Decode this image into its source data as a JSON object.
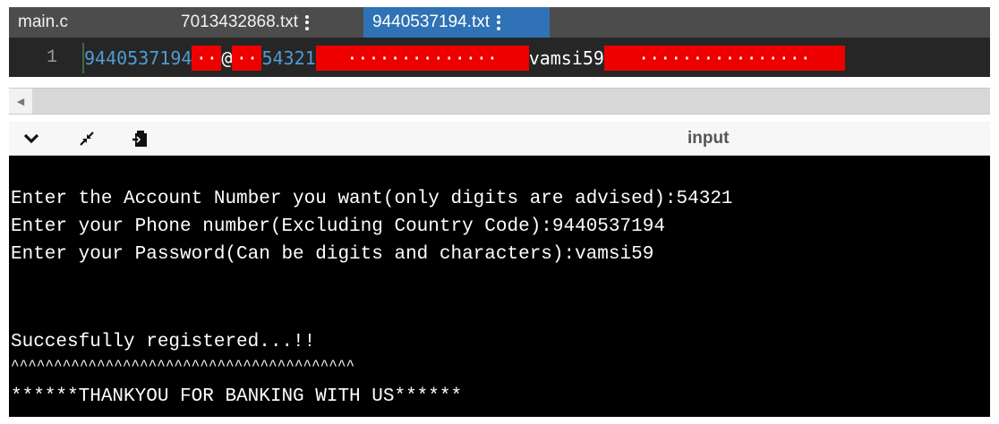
{
  "tabs": [
    {
      "label": "main.c",
      "active": false
    },
    {
      "label": "7013432868.txt",
      "active": false
    },
    {
      "label": "9440537194.txt",
      "active": true
    }
  ],
  "editor": {
    "line_number": "1",
    "tokens": {
      "t1": "9440537194",
      "ws1": "··",
      "t2": "@",
      "ws2": "··",
      "t3": "54321",
      "ws3": "··············",
      "t4": "vamsi59",
      "ws4": "················"
    }
  },
  "console": {
    "input_label": "input",
    "tools": [
      "chevron-down-icon",
      "shrink-icon",
      "clipboard-icon"
    ]
  },
  "terminal": {
    "lines": [
      "",
      "Enter the Account Number you want(only digits are advised):54321",
      "Enter your Phone number(Excluding Country Code):9440537194",
      "Enter your Password(Can be digits and characters):vamsi59",
      "",
      "",
      "Succesfully registered...!!",
      "^^^^^^^^^^^^^^^^^^^^^^^^^^^^^^^^^^^^^^^^",
      "******THANKYOU FOR BANKING WITH US******"
    ]
  },
  "colors": {
    "tab_bar": "#4c4c4c",
    "tab_active": "#2f72b5",
    "editor_bg": "#262626",
    "number_token": "#4f9bd4",
    "whitespace_highlight": "#ef0000",
    "terminal_bg": "#000000"
  }
}
